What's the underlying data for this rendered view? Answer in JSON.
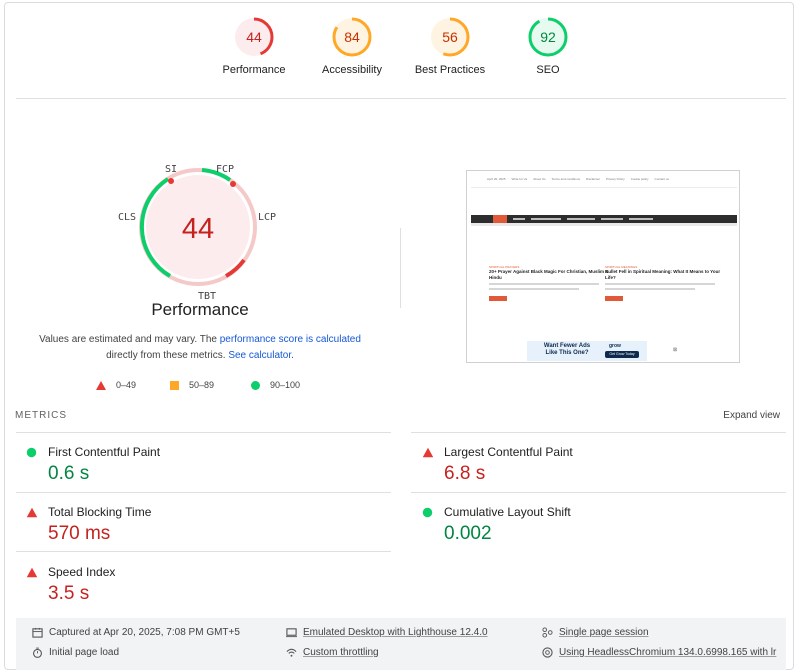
{
  "scores": [
    {
      "value": "44",
      "label": "Performance",
      "level": "fail",
      "fraction": 0.44
    },
    {
      "value": "84",
      "label": "Accessibility",
      "level": "average",
      "fraction": 0.84
    },
    {
      "value": "56",
      "label": "Best Practices",
      "level": "average",
      "fraction": 0.56
    },
    {
      "value": "92",
      "label": "SEO",
      "level": "pass",
      "fraction": 0.92
    }
  ],
  "colors": {
    "fail": "#e53935",
    "average": "#ffa726",
    "pass": "#0cce6b"
  },
  "performance": {
    "score": "44",
    "title": "Performance",
    "metric_labels": {
      "si": "SI",
      "fcp": "FCP",
      "lcp": "LCP",
      "tbt": "TBT",
      "cls": "CLS"
    },
    "desc_prefix": "Values are estimated and may vary. The ",
    "desc_link1": "performance score is calculated",
    "desc_middle": " directly from these metrics. ",
    "desc_link2": "See calculator."
  },
  "legend": [
    {
      "shape": "triangle",
      "range": "0–49"
    },
    {
      "shape": "square",
      "range": "50–89"
    },
    {
      "shape": "circle",
      "range": "90–100"
    }
  ],
  "thumbnail": {
    "topbar": [
      "April 20, 2025",
      "Write for Us",
      "About Us",
      "Terms and conditions",
      "Disclaimer",
      "Privacy Policy",
      "Cookie policy",
      "Contact us"
    ],
    "nav": [
      "HOME",
      "DREAMS",
      "SPIRITUAL MEANINGS",
      "SPIRITUAL PRAYERS",
      "ANGEL NUMBERS",
      "SPIRITUAL GUIDE"
    ],
    "card1_cat": "SPIRITUAL PRAYERS",
    "card1_title": "20+ Prayer Against Black Magic For Christian, Muslim & Hindu",
    "card2_cat": "SPIRITUAL MEANINGS",
    "card2_title": "Bullet Fell in Spiritual Meaning: What It Means to Your Life?",
    "ad_text": "Want Fewer Ads Like This One?",
    "ad_brand": "grow",
    "ad_cta": "Get Grow Today"
  },
  "metrics_section": {
    "title": "METRICS",
    "expand": "Expand view"
  },
  "metrics": [
    {
      "name": "First Contentful Paint",
      "value": "0.6 s",
      "status": "pass"
    },
    {
      "name": "Largest Contentful Paint",
      "value": "6.8 s",
      "status": "fail"
    },
    {
      "name": "Total Blocking Time",
      "value": "570 ms",
      "status": "fail"
    },
    {
      "name": "Cumulative Layout Shift",
      "value": "0.002",
      "status": "pass"
    },
    {
      "name": "Speed Index",
      "value": "3.5 s",
      "status": "fail"
    }
  ],
  "footer": {
    "captured": "Captured at Apr 20, 2025, 7:08 PM GMT+5",
    "initial_load": "Initial page load",
    "emulated": "Emulated Desktop with Lighthouse 12.4.0",
    "throttling": "Custom throttling",
    "session": "Single page session",
    "browser": "Using HeadlessChromium 134.0.6998.165 with lr"
  }
}
